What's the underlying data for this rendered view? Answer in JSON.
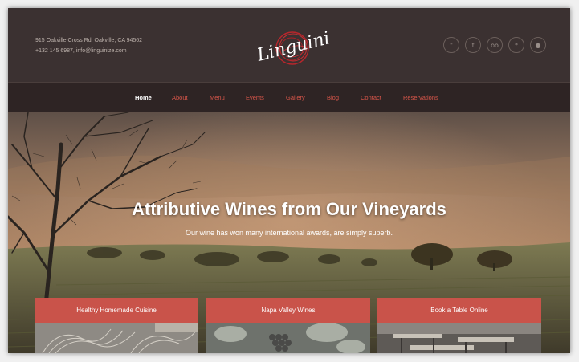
{
  "header": {
    "address_line1": "915 Oakville Cross Rd, Oakville, CA 94562",
    "address_line2": "+132 145 6987, info@linguinize.com",
    "logo_text": "Linguini"
  },
  "social": [
    {
      "name": "twitter",
      "glyph": "t"
    },
    {
      "name": "facebook",
      "glyph": "f"
    },
    {
      "name": "tripadvisor",
      "glyph": "oo"
    },
    {
      "name": "yelp",
      "glyph": "*"
    },
    {
      "name": "foursquare",
      "glyph": "●"
    }
  ],
  "nav": {
    "items": [
      "Home",
      "About",
      "Menu",
      "Events",
      "Gallery",
      "Blog",
      "Contact",
      "Reservations"
    ],
    "active": "Home"
  },
  "hero": {
    "title": "Attributive Wines from Our Vineyards",
    "subtitle": "Our wine has won many international awards, are simply superb."
  },
  "cards": [
    {
      "label": "Healthy Homemade Cuisine"
    },
    {
      "label": "Napa Valley Wines"
    },
    {
      "label": "Book a Table Online"
    }
  ],
  "colors": {
    "accent": "#d8564a",
    "header_bg": "#3b3131",
    "nav_bg": "#2e2424",
    "card_button": "#c9534a"
  }
}
